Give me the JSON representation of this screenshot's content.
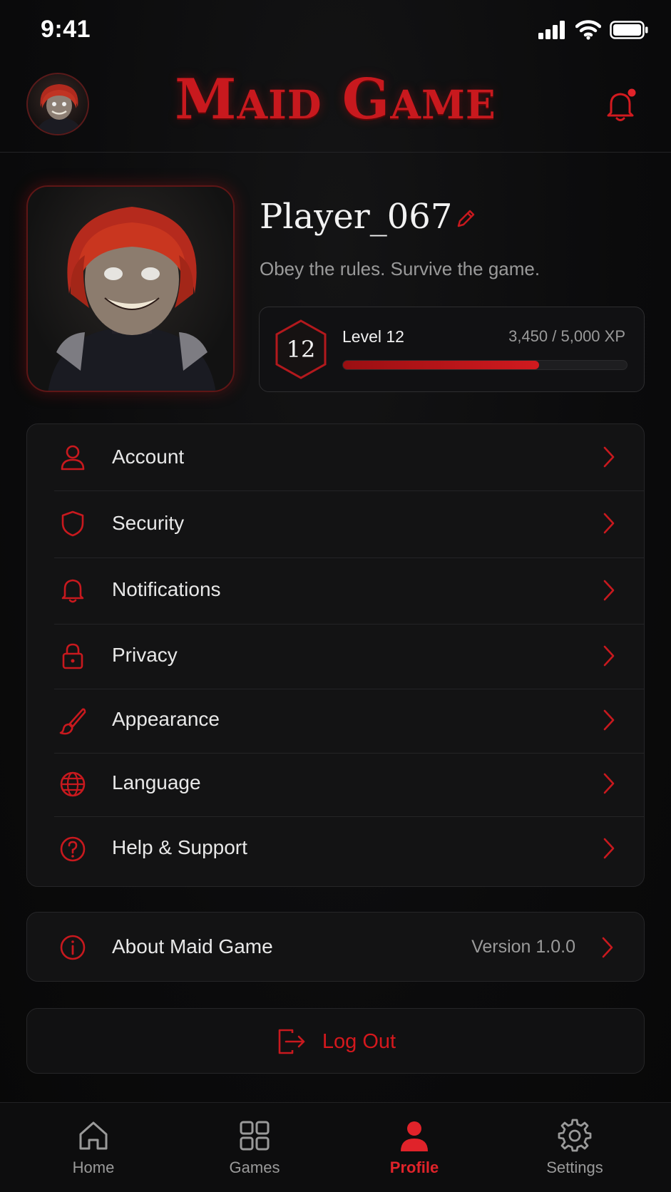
{
  "status_bar": {
    "time": "9:41"
  },
  "header": {
    "title": "Maid Game"
  },
  "profile": {
    "username": "Player_067",
    "tagline": "Obey the rules. Survive the game.",
    "level_number": "12",
    "level_label": "Level 12",
    "xp_text": "3,450 / 5,000 XP",
    "xp_progress": 0.69
  },
  "menu": {
    "items": [
      {
        "label": "Account",
        "icon": "user-icon"
      },
      {
        "label": "Security",
        "icon": "shield-icon"
      },
      {
        "label": "Notifications",
        "icon": "bell-icon"
      },
      {
        "label": "Privacy",
        "icon": "lock-icon"
      },
      {
        "label": "Appearance",
        "icon": "brush-icon"
      },
      {
        "label": "Language",
        "icon": "globe-icon"
      },
      {
        "label": "Help & Support",
        "icon": "question-circle-icon"
      }
    ]
  },
  "about": {
    "label": "About Maid Game",
    "version": "Version 1.0.0",
    "icon": "info-circle-icon"
  },
  "logout": {
    "label": "Log Out",
    "icon": "logout-icon"
  },
  "tab_bar": {
    "tabs": [
      {
        "label": "Home",
        "icon": "home-icon"
      },
      {
        "label": "Games",
        "icon": "grid-icon"
      },
      {
        "label": "Profile",
        "icon": "user-filled-icon",
        "active": true
      },
      {
        "label": "Settings",
        "icon": "gear-icon"
      }
    ]
  },
  "colors": {
    "accent": "#d11a1f",
    "background": "#0b0b0c",
    "card": "#131314",
    "text_muted": "#9a9a9a"
  }
}
